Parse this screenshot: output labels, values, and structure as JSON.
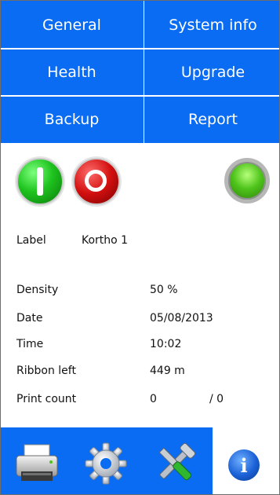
{
  "menu": {
    "general": "General",
    "system_info": "System info",
    "health": "Health",
    "upgrade": "Upgrade",
    "backup": "Backup",
    "report": "Report"
  },
  "status": {
    "start_icon": "power-on-icon",
    "stop_icon": "stop-icon",
    "indicator": "status-led-green"
  },
  "label": {
    "caption": "Label",
    "value": "Kortho 1"
  },
  "info": {
    "density_label": "Density",
    "density_value": "50 %",
    "date_label": "Date",
    "date_value": "05/08/2013",
    "time_label": "Time",
    "time_value": "10:02",
    "ribbon_label": "Ribbon left",
    "ribbon_value": "449 m",
    "count_label": "Print count",
    "count_value": "0",
    "count_total": "/ 0"
  },
  "toolbar": {
    "print_icon": "printer-icon",
    "settings_icon": "gear-icon",
    "tools_icon": "tools-icon",
    "info_icon": "info-icon",
    "info_glyph": "i"
  },
  "colors": {
    "accent": "#0a6cf2",
    "on_green": "#1fc41f",
    "off_red": "#d20f0f"
  }
}
